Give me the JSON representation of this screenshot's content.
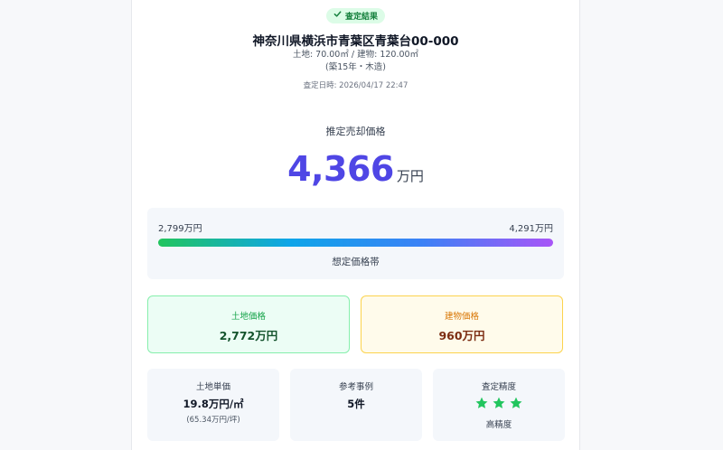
{
  "result": {
    "badge": "査定結果",
    "address": "神奈川県横浜市青葉区青葉台00-000",
    "area_line": "土地: 70.00㎡ / 建物: 120.00㎡",
    "age_line": "(築15年・木造)",
    "assessed_at": "査定日時: 2026/04/17 22:47"
  },
  "estimate": {
    "label": "推定売却価格",
    "value": "4,366",
    "unit": "万円"
  },
  "range": {
    "low": "2,799万円",
    "high": "4,291万円",
    "caption": "想定価格帯",
    "gradient_colors": [
      "#22c55e",
      "#0ea5e9",
      "#3b82f6",
      "#a855f7"
    ]
  },
  "breakdown": {
    "land_label": "土地価格",
    "land_value": "2,772万円",
    "building_label": "建物価格",
    "building_value": "960万円"
  },
  "stats": {
    "unit_price_label": "土地単価",
    "unit_price_value": "19.8万円/㎡",
    "unit_price_tsubo": "(65.34万円/坪)",
    "cases_label": "参考事例",
    "cases_value": "5件",
    "accuracy_label": "査定精度",
    "accuracy_stars": 3,
    "accuracy_text": "高精度"
  },
  "colors": {
    "accent": "#4f46e5",
    "success": "#16a34a",
    "warning": "#d97706",
    "star": "#22c55e"
  }
}
